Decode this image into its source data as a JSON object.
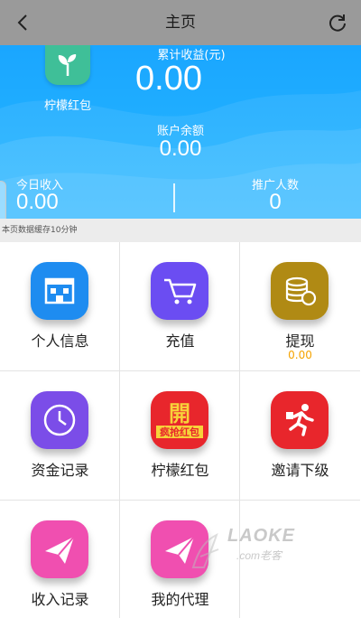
{
  "header": {
    "title": "主页",
    "back_icon": "chevron-left-icon",
    "refresh_icon": "refresh-icon"
  },
  "hero": {
    "logo_label": "柠檬红包",
    "cumulative_label": "累计收益(元)",
    "cumulative_value": "0.00",
    "balance_label": "账户余额",
    "balance_value": "0.00",
    "today_label": "今日收入",
    "today_value": "0.00",
    "promo_label": "推广人数",
    "promo_value": "0",
    "color": "#1aa6ff"
  },
  "cache_note": "本页数据缓存10分钟",
  "menu": [
    {
      "label": "个人信息",
      "icon": "building-icon",
      "color": "#1e8cf0"
    },
    {
      "label": "充值",
      "icon": "cart-icon",
      "color": "#6b4df2"
    },
    {
      "label": "提现",
      "sub": "0.00",
      "icon": "coins-icon",
      "color": "#b08a14"
    },
    {
      "label": "资金记录",
      "icon": "clock-icon",
      "color": "#7b4de8"
    },
    {
      "label": "柠檬红包",
      "icon": "red-envelope-icon",
      "color": "#e8262c"
    },
    {
      "label": "邀请下级",
      "icon": "running-man-icon",
      "color": "#e8262c"
    },
    {
      "label": "收入记录",
      "icon": "paper-plane-icon",
      "color": "#f04fb0"
    },
    {
      "label": "我的代理",
      "icon": "paper-plane-icon",
      "color": "#f04fb0"
    }
  ],
  "redpack_icon_text": {
    "top": "開",
    "bottom": "疯抢红包"
  },
  "watermark": {
    "text": "LAOKE",
    "sub": ".com老客"
  }
}
